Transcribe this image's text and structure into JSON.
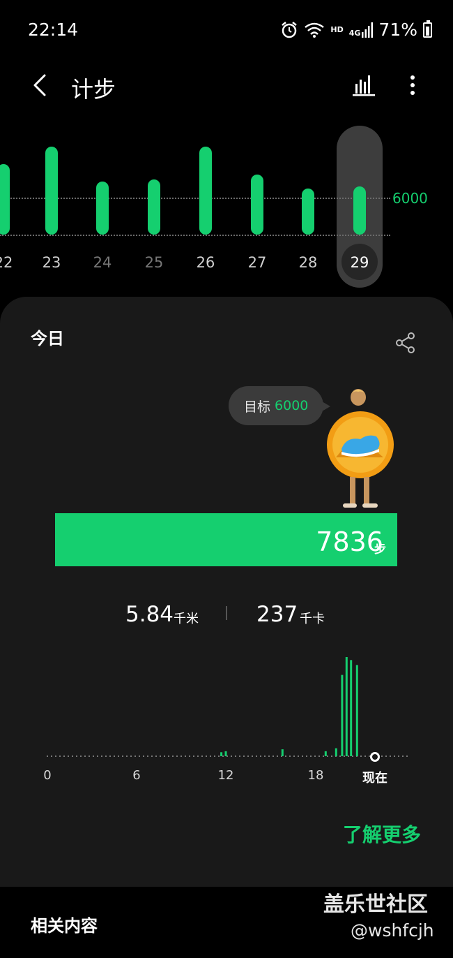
{
  "status_bar": {
    "time": "22:14",
    "hd": "HD",
    "net": "4G",
    "battery": "71%"
  },
  "app_bar": {
    "title": "计步",
    "icons": [
      "back-arrow-icon",
      "bar-chart-icon",
      "more-vertical-icon"
    ]
  },
  "day_strip": {
    "goal_label": "6000",
    "days": [
      {
        "label": "22",
        "level": 0.8,
        "dim": false
      },
      {
        "label": "23",
        "level": 1.0,
        "dim": false
      },
      {
        "label": "24",
        "level": 0.6,
        "dim": true
      },
      {
        "label": "25",
        "level": 0.63,
        "dim": true
      },
      {
        "label": "26",
        "level": 1.0,
        "dim": false
      },
      {
        "label": "27",
        "level": 0.68,
        "dim": false
      },
      {
        "label": "28",
        "level": 0.52,
        "dim": false
      },
      {
        "label": "29",
        "level": 0.55,
        "dim": false,
        "selected": true
      }
    ]
  },
  "today": {
    "label": "今日",
    "goal_prefix": "目标",
    "goal_value": "6000",
    "steps": "7836",
    "steps_unit": "步",
    "distance": "5.84",
    "distance_unit": "千米",
    "calories": "237",
    "calories_unit": "千卡"
  },
  "hour_chart": {
    "x_labels": [
      "0",
      "6",
      "12",
      "18",
      "现在"
    ]
  },
  "chart_data": {
    "type": "bar",
    "title": "",
    "xlabel": "",
    "ylabel": "",
    "x_ticks": [
      "0",
      "6",
      "12",
      "18",
      "现在"
    ],
    "note_values": "relative activity level per time slot (0–1)",
    "series": [
      {
        "values": [
          {
            "hour": 11.6,
            "v": 0.04
          },
          {
            "hour": 11.9,
            "v": 0.05
          },
          {
            "hour": 15.7,
            "v": 0.07
          },
          {
            "hour": 18.6,
            "v": 0.05
          },
          {
            "hour": 19.3,
            "v": 0.08
          },
          {
            "hour": 19.7,
            "v": 0.82
          },
          {
            "hour": 20.0,
            "v": 1.0
          },
          {
            "hour": 20.3,
            "v": 0.97
          },
          {
            "hour": 20.7,
            "v": 0.92
          }
        ]
      }
    ]
  },
  "learn_more": "了解更多",
  "related": "相关内容",
  "watermark": {
    "title": "盖乐世社区",
    "user": "@wshfcjh"
  }
}
